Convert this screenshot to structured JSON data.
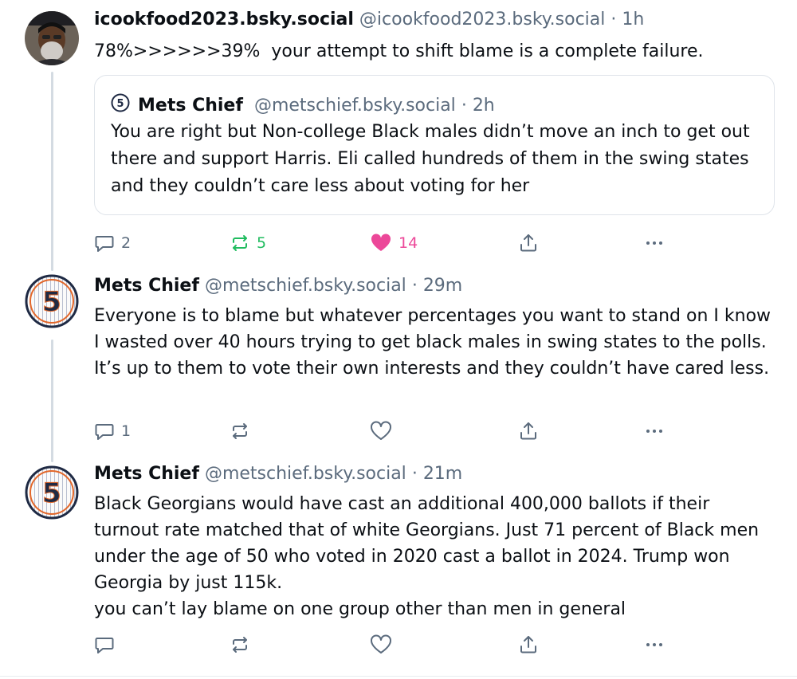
{
  "posts": [
    {
      "author": "icookfood2023.bsky.social",
      "handle": "@icookfood2023.bsky.social",
      "time": "1h",
      "text": "78%>>>>>>39%  your attempt to shift blame is a complete failure.",
      "quote": {
        "author": "Mets Chief",
        "handle": "@metschief.bsky.social",
        "time": "2h",
        "text": "You are right but Non-college Black males didn’t move an inch to get out there and support Harris. Eli called hundreds of them in the swing states and they couldn’t care less about voting for her"
      },
      "replies": "2",
      "reposts": "5",
      "likes": "14"
    },
    {
      "author": "Mets Chief",
      "handle": "@metschief.bsky.social",
      "time": "29m",
      "text": "Everyone is to blame but whatever percentages you want to stand on I know I wasted over 40 hours trying to get black males in swing states to the polls. It’s up to them to vote their own interests and they couldn’t have cared less.",
      "replies": "1",
      "reposts": "",
      "likes": ""
    },
    {
      "author": "Mets Chief",
      "handle": "@metschief.bsky.social",
      "time": "21m",
      "text": "Black Georgians would have cast an additional 400,000 ballots if their turnout rate matched that of white Georgians. Just 71 percent of Black men under the age of 50 who voted in 2020 cast a ballot in 2024. Trump won Georgia by just 115k.\nyou can’t lay blame on one group other than men in general",
      "replies": "",
      "reposts": "",
      "likes": ""
    }
  ],
  "avatar_badge_number": "5",
  "sep": "·",
  "colors": {
    "repost_active": "#20bc5f",
    "like_active": "#ec4899",
    "muted": "#5b6b7d",
    "thread_line": "#d4dbe2"
  }
}
